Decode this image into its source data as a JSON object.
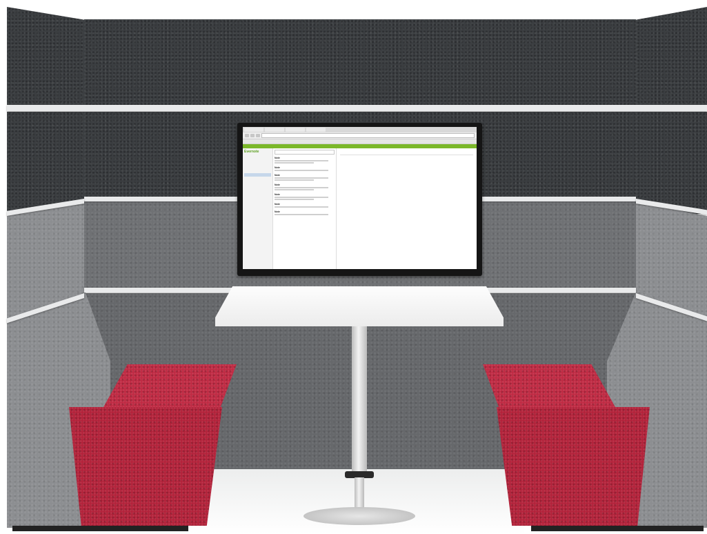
{
  "scene": {
    "subject": "acoustic-meeting-booth",
    "colors": {
      "felt_dark": "#3b3e41",
      "felt_mid": "#6f7174",
      "felt_light": "#8c8e91",
      "seat_red": "#b3223a",
      "trim": "#e9eaeb",
      "table": "#f4f4f4"
    }
  },
  "screen": {
    "app_logo": "Evernote",
    "notes": [
      {
        "title": "Note"
      },
      {
        "title": "Note"
      },
      {
        "title": "Note"
      },
      {
        "title": "Note"
      },
      {
        "title": "Note"
      },
      {
        "title": "Note"
      },
      {
        "title": "Note"
      }
    ],
    "detail_lines": [
      "",
      "",
      "",
      ""
    ]
  }
}
